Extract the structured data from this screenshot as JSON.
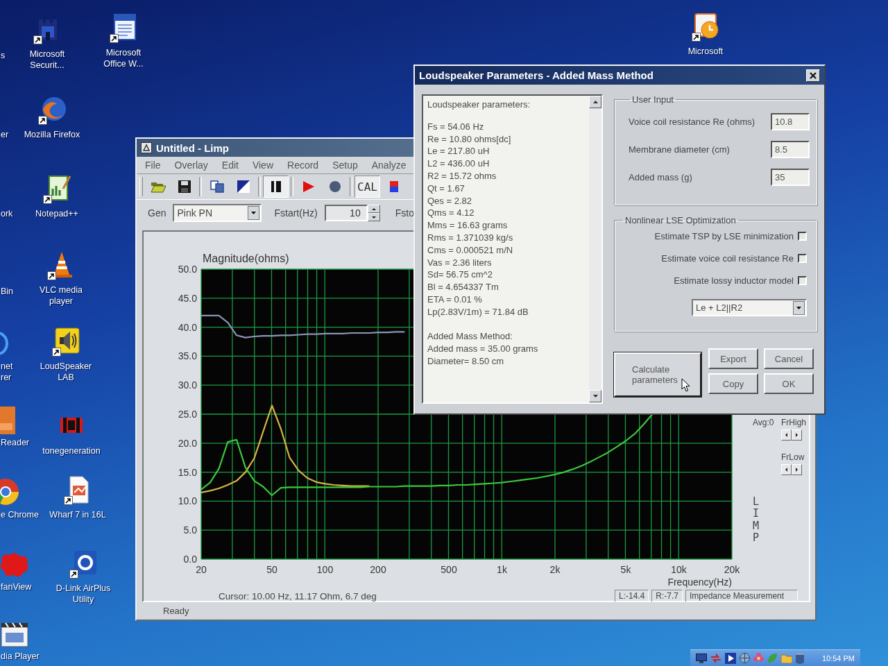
{
  "desktop_icons": [
    {
      "label": "Microsoft Securit..."
    },
    {
      "label": "Microsoft Office W..."
    },
    {
      "label": "Mozilla Firefox"
    },
    {
      "label": "Notepad++"
    },
    {
      "label": "VLC media player"
    },
    {
      "label": "LoudSpeaker LAB"
    },
    {
      "label": "tonegeneration"
    },
    {
      "label": "Wharf 7 in 16L"
    },
    {
      "label": "D-Link AirPlus Utility"
    },
    {
      "label": "Microsoft"
    }
  ],
  "desktop_icons_cut": [
    {
      "label": "s"
    },
    {
      "label": "er"
    },
    {
      "label": "ork"
    },
    {
      "label": "Bin"
    },
    {
      "label": "net\nrer"
    },
    {
      "label": "Reader"
    },
    {
      "label": "e Chrome"
    },
    {
      "label": "fanView"
    },
    {
      "label": "dia Player"
    }
  ],
  "limp_window": {
    "title": "Untitled - Limp",
    "menu": [
      "File",
      "Overlay",
      "Edit",
      "View",
      "Record",
      "Setup",
      "Analyze"
    ],
    "toolbar": [
      {
        "pressed": false
      },
      {
        "pressed": false
      },
      {
        "pressed": false
      },
      {
        "pressed": false
      },
      {
        "pressed": true
      },
      {
        "pressed": false
      },
      {
        "pressed": false
      },
      {
        "label": "CAL",
        "pressed": true
      },
      {
        "pressed": false
      }
    ],
    "generator": {
      "label": "Gen",
      "value": "Pink PN"
    },
    "fstart": {
      "label": "Fstart(Hz)",
      "value": "10"
    },
    "fstop_label": "Fsto",
    "chart_data": {
      "type": "line",
      "title": "Magnitude(ohms)",
      "xlabel": "Frequency(Hz)",
      "grid": true,
      "categories": [
        "20",
        null,
        null,
        null,
        null,
        null,
        null,
        null,
        "50",
        null,
        null,
        null,
        null,
        null,
        "100",
        null,
        null,
        null,
        null,
        null,
        "200",
        null,
        null,
        null,
        null,
        null,
        null,
        null,
        "500",
        null,
        null,
        null,
        null,
        null,
        "1k",
        null,
        null,
        null,
        null,
        null,
        "2k",
        null,
        null,
        null,
        null,
        null,
        null,
        null,
        "5k",
        null,
        null,
        null,
        null,
        null,
        "10k",
        null,
        null,
        null,
        null,
        null,
        "20k"
      ],
      "series": [
        {
          "color": "#8d95b5",
          "values": [
            42,
            42,
            42,
            40.8,
            38.6,
            38.2,
            38.4,
            38.5,
            38.5,
            38.6,
            38.6,
            38.7,
            38.8,
            38.8,
            38.9,
            38.9,
            38.9,
            39,
            39,
            39,
            39.1,
            39.1,
            39.2,
            39.2,
            null,
            null,
            null,
            null,
            null,
            null,
            null,
            null,
            null,
            null,
            null,
            null,
            null,
            null,
            null,
            null,
            null,
            null,
            null,
            null,
            null,
            null,
            null,
            null,
            null,
            null,
            null,
            null,
            null,
            null,
            null,
            null,
            null,
            null,
            null,
            null,
            null
          ]
        },
        {
          "color": "#d9b443",
          "values": [
            11.5,
            11.8,
            12.2,
            12.8,
            13.5,
            15,
            17.4,
            22,
            26.5,
            22.5,
            17.5,
            15.3,
            14,
            13.3,
            13,
            12.8,
            12.7,
            12.6,
            12.6,
            12.6,
            null,
            null,
            null,
            null,
            null,
            null,
            null,
            null,
            null,
            null,
            null,
            null,
            null,
            null,
            null,
            null,
            null,
            null,
            null,
            null,
            null,
            null,
            null,
            null,
            null,
            null,
            null,
            null,
            null,
            null,
            null,
            null,
            null,
            null,
            null,
            null,
            null,
            null,
            null,
            null,
            null
          ]
        },
        {
          "color": "#3cc83c",
          "values": [
            12,
            13.2,
            15.6,
            20.2,
            20.6,
            15.8,
            13.5,
            12.5,
            11,
            12.3,
            12.4,
            12.4,
            12.4,
            12.4,
            12.4,
            12.4,
            12.4,
            12.4,
            12.4,
            12.5,
            12.5,
            12.5,
            12.5,
            12.6,
            12.6,
            12.6,
            12.6,
            12.7,
            12.7,
            12.8,
            12.8,
            12.9,
            13,
            13.1,
            13.2,
            13.4,
            13.6,
            13.8,
            14,
            14.3,
            14.6,
            15,
            15.5,
            16.1,
            16.8,
            17.6,
            18.4,
            19.4,
            20.4,
            21.6,
            23.2,
            25,
            null,
            null,
            null,
            null,
            null,
            null,
            null,
            null,
            null
          ]
        }
      ],
      "ylim": [
        0,
        50
      ],
      "yticks": [
        {
          "value": 0,
          "label": "0.0"
        },
        {
          "value": 5,
          "label": "5.0"
        },
        {
          "value": 10,
          "label": "10.0"
        },
        {
          "value": 15,
          "label": "15.0"
        },
        {
          "value": 20,
          "label": "20.0"
        },
        {
          "value": 25,
          "label": "25.0"
        },
        {
          "value": 30,
          "label": "30.0"
        },
        {
          "value": 35,
          "label": "35.0"
        },
        {
          "value": 40,
          "label": "40.0"
        },
        {
          "value": 45,
          "label": "45.0"
        },
        {
          "value": 50,
          "label": "50.0"
        }
      ]
    },
    "side": {
      "avg": "Avg:0",
      "fr_high": "FrHigh",
      "fr_low": "FrLow",
      "brand": "LIMP"
    },
    "cursor_readout": "Cursor: 10.00 Hz, 11.17 Ohm, 6.7 deg",
    "status_fields": [
      "L:-14.4",
      "R:-7.7",
      "Impedance Measurement"
    ],
    "status": "Ready"
  },
  "params_dialog": {
    "title": "Loudspeaker Parameters - Added Mass Method",
    "report": {
      "heading": "Loudspeaker parameters:",
      "parameters": [
        "Fs = 54.06 Hz",
        "Re = 10.80 ohms[dc]",
        "Le = 217.80 uH",
        "L2 = 436.00 uH",
        "R2 = 15.72 ohms",
        "Qt = 1.67",
        "Qes = 2.82",
        "Qms = 4.12",
        "Mms = 16.63 grams",
        "Rms = 1.371039 kg/s",
        "Cms = 0.000521 m/N",
        "Vas = 2.36 liters",
        "Sd= 56.75 cm^2",
        "Bl = 4.654337 Tm",
        "ETA = 0.01 %",
        "Lp(2.83V/1m) = 71.84 dB"
      ],
      "method_heading": "Added Mass Method:",
      "method_lines": [
        "Added mass = 35.00 grams",
        "Diameter= 8.50 cm"
      ]
    },
    "user_input": {
      "title": "User Input",
      "fields": [
        {
          "label": "Voice coil resistance Re (ohms)",
          "value": "10.8"
        },
        {
          "label": "Membrane diameter (cm)",
          "value": "8.5"
        },
        {
          "label": "Added mass (g)",
          "value": "35"
        }
      ]
    },
    "optimization": {
      "title": "Nonlinear LSE Optimization",
      "options": [
        {
          "label": "Estimate TSP by LSE minimization",
          "checked": false
        },
        {
          "label": "Estimate voice coil resistance Re",
          "checked": false
        },
        {
          "label": "Estimate lossy inductor model",
          "checked": false
        }
      ],
      "model": "Le + L2||R2"
    },
    "calculate_button": {
      "label": "Calculate parameters",
      "focused": true
    },
    "buttons": [
      "Export",
      "Cancel",
      "Copy",
      "OK"
    ]
  },
  "tray": {
    "clock": "10:54 PM"
  }
}
